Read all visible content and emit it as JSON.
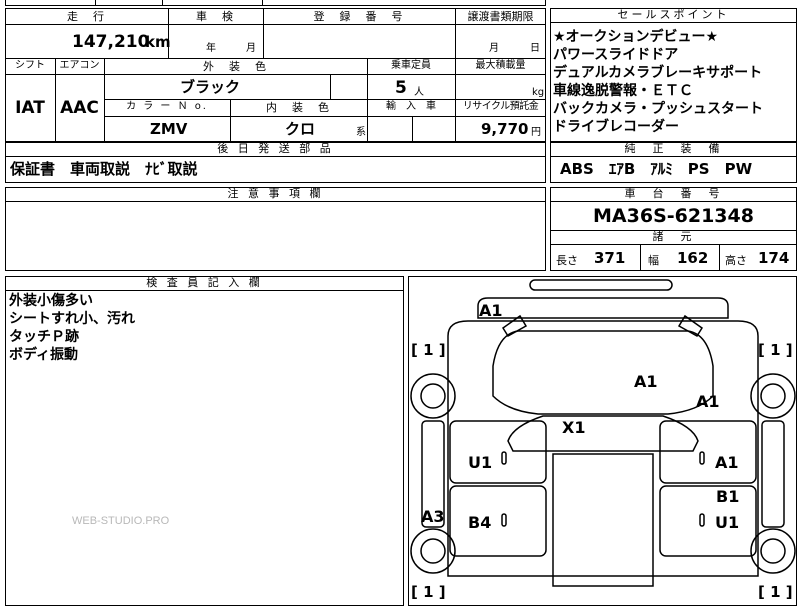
{
  "headers": {
    "mileage": "走　行",
    "inspection": "車　検",
    "registration": "登　録　番　号",
    "transfer_deadline": "譲渡書類期限",
    "sales_points": "セールスポイント",
    "shift": "シフト",
    "aircon": "エアコン",
    "exterior_color": "外　装　色",
    "capacity": "乗車定員",
    "max_load": "最大積載量",
    "color_no": "カ ラ ー Ｎ o.",
    "interior_color": "内　装　色",
    "import": "輸　入　車",
    "recycle": "リサイクル預託金",
    "later_parts": "後 日 発 送 部 品",
    "genuine_equipment": "純　正　装　備",
    "notes": "注 意 事 項 欄",
    "chassis_number": "車　台　番　号",
    "specs": "諸　元",
    "inspector_notes": "検 査 員 記 入 欄"
  },
  "vehicle": {
    "mileage": "147,210",
    "mileage_unit": "km",
    "inspection_year_unit": "年",
    "inspection_month_unit": "月",
    "deadline_month_unit": "月",
    "deadline_day_unit": "日",
    "shift": "IAT",
    "aircon": "AAC",
    "exterior_color": "ブラック",
    "capacity": "5",
    "capacity_unit": "人",
    "max_load_unit": "kg",
    "color_no": "ZMV",
    "interior_color": "クロ",
    "interior_suffix": "系",
    "recycle_fee": "9,770",
    "recycle_unit": "円",
    "later_parts": "保証書　車両取説　ﾅﾋﾞ取説",
    "genuine_equipment": "ABS　ｴｱB　ｱﾙﾐ　PS　PW",
    "chassis_number": "MA36S-621348",
    "length_label": "長さ",
    "length": "371",
    "width_label": "幅",
    "width": "162",
    "height_label": "高さ",
    "height": "174"
  },
  "sales_points": [
    "★オークションデビュー★",
    "パワースライドドア",
    "デュアルカメラブレーキサポート",
    "車線逸脱警報・ＥＴＣ",
    "バックカメラ・プッシュスタート",
    "ドライブレコーダー"
  ],
  "inspector_notes": [
    "外装小傷多い",
    "シートすれ小、汚れ",
    "タッチＰ跡",
    "ボディ振動"
  ],
  "watermark": "WEB-STUDIO.PRO",
  "diagram": {
    "tire_left_top": "[ 1 ]",
    "tire_right_top": "[ 1 ]",
    "tire_left_bottom": "[ 1 ]",
    "tire_right_bottom": "[ 1 ]",
    "damage_front": "A1",
    "damage_hood": "A1",
    "damage_right_fender": "A1",
    "damage_roof": "X1",
    "damage_left_front_door": "U1",
    "damage_right_front_door": "A1",
    "damage_left_rear_door": "B4",
    "damage_right_rear_door_b": "B1",
    "damage_right_rear_door_u": "U1",
    "damage_left_rear": "A3"
  }
}
